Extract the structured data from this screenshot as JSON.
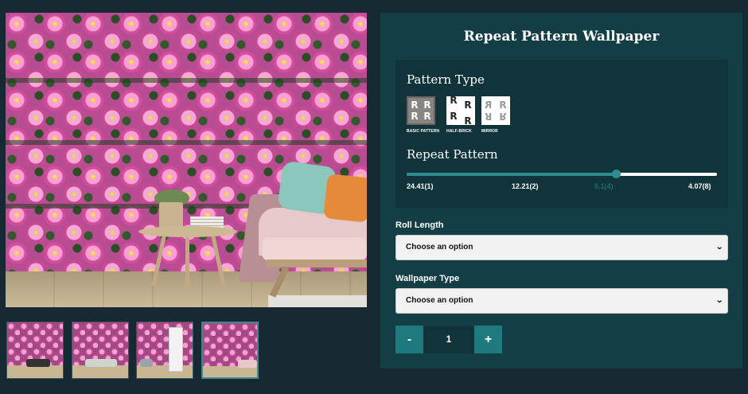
{
  "gallery": {
    "main_image": {
      "alt_name": "floral-wallpaper-room-scene"
    },
    "thumbnails": [
      {
        "name": "thumbnail-1",
        "active": false
      },
      {
        "name": "thumbnail-2",
        "active": false
      },
      {
        "name": "thumbnail-3",
        "active": false
      },
      {
        "name": "thumbnail-4",
        "active": true
      }
    ]
  },
  "product": {
    "title": "Repeat Pattern Wallpaper"
  },
  "pattern_type": {
    "heading": "Pattern Type",
    "options": [
      {
        "label": "BASIC PATTERN",
        "icon": "basic-pattern-icon",
        "glyph": "R",
        "selected": true
      },
      {
        "label": "HALF-BRICK",
        "icon": "half-brick-pattern-icon",
        "glyph": "R",
        "selected": false
      },
      {
        "label": "MIRROR",
        "icon": "mirror-pattern-icon",
        "glyph": "R",
        "selected": false
      }
    ]
  },
  "repeat_pattern": {
    "heading": "Repeat Pattern",
    "slider_value_fraction": 0.675,
    "ticks": [
      "24.41(1)",
      "12.21(2)",
      "6.1(4)",
      "4.07(8)"
    ],
    "active_tick_index": 2
  },
  "roll_length": {
    "label": "Roll Length",
    "selected": "Choose an option"
  },
  "wallpaper_type": {
    "label": "Wallpaper Type",
    "selected": "Choose an option"
  },
  "quantity": {
    "decrement_label": "-",
    "value": "1",
    "increment_label": "+"
  },
  "colors": {
    "background": "#172a33",
    "panel": "#143e46",
    "accent": "#1f7a80",
    "slider_active": "#2d8c8e"
  }
}
